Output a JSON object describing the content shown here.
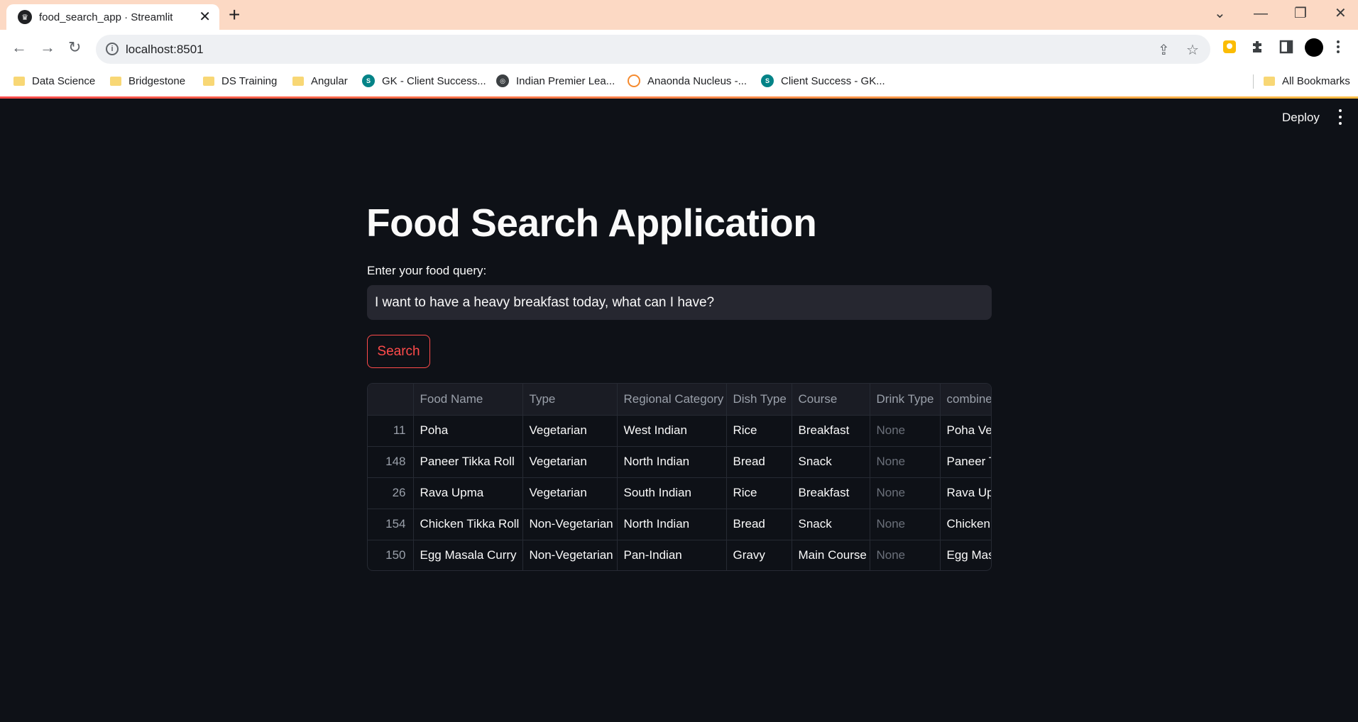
{
  "browser": {
    "tab_title": "food_search_app · Streamlit",
    "url": "localhost:8501",
    "bookmarks": [
      {
        "label": "Data Science",
        "icon": "folder-icon"
      },
      {
        "label": "Bridgestone",
        "icon": "folder-icon"
      },
      {
        "label": "DS Training",
        "icon": "folder-icon"
      },
      {
        "label": "Angular",
        "icon": "folder-icon"
      },
      {
        "label": "GK - Client Success...",
        "icon": "sharepoint-icon"
      },
      {
        "label": "Indian Premier Lea...",
        "icon": "globe-icon"
      },
      {
        "label": "Anaonda Nucleus -...",
        "icon": "anaconda-icon"
      },
      {
        "label": "Client Success - GK...",
        "icon": "sharepoint-icon"
      }
    ],
    "all_bookmarks": "All Bookmarks"
  },
  "app": {
    "deploy_label": "Deploy",
    "title": "Food Search Application",
    "query_label": "Enter your food query:",
    "query_value": "I want to have a heavy breakfast today, what can I have?",
    "search_label": "Search",
    "accent_color": "#ff4b4b"
  },
  "table": {
    "columns": [
      "",
      "Food Name",
      "Type",
      "Regional Category",
      "Dish Type",
      "Course",
      "Drink Type",
      "combine"
    ],
    "rows": [
      {
        "idx": "11",
        "food": "Poha",
        "type": "Vegetarian",
        "region": "West Indian",
        "dish": "Rice",
        "course": "Breakfast",
        "drink": "None",
        "combined": "Poha Veg"
      },
      {
        "idx": "148",
        "food": "Paneer Tikka Roll",
        "type": "Vegetarian",
        "region": "North Indian",
        "dish": "Bread",
        "course": "Snack",
        "drink": "None",
        "combined": "Paneer T"
      },
      {
        "idx": "26",
        "food": "Rava Upma",
        "type": "Vegetarian",
        "region": "South Indian",
        "dish": "Rice",
        "course": "Breakfast",
        "drink": "None",
        "combined": "Rava Upr"
      },
      {
        "idx": "154",
        "food": "Chicken Tikka Roll",
        "type": "Non-Vegetarian",
        "region": "North Indian",
        "dish": "Bread",
        "course": "Snack",
        "drink": "None",
        "combined": "Chicken T"
      },
      {
        "idx": "150",
        "food": "Egg Masala Curry",
        "type": "Non-Vegetarian",
        "region": "Pan-Indian",
        "dish": "Gravy",
        "course": "Main Course",
        "drink": "None",
        "combined": "Egg Masa"
      }
    ]
  }
}
